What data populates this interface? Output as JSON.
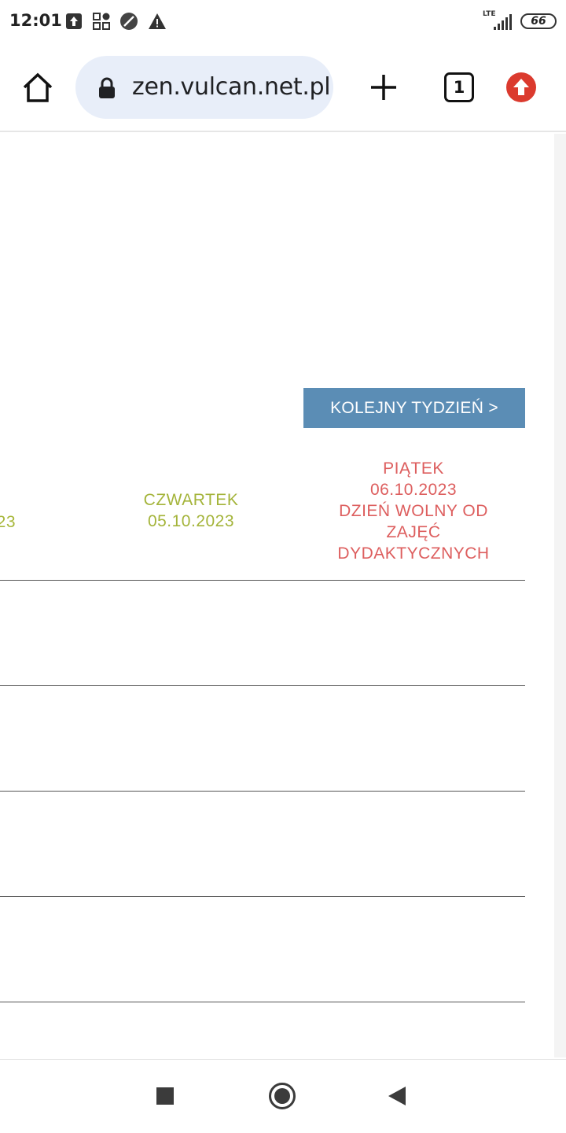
{
  "status_bar": {
    "time": "12:01",
    "icons": [
      "upload-icon",
      "apps-grid-icon",
      "data-saver-icon",
      "warning-icon"
    ],
    "network": "LTE",
    "battery": "66"
  },
  "browser": {
    "url": "zen.vulcan.net.pl",
    "tab_count": "1",
    "accent_color": "#db3a2e"
  },
  "page": {
    "next_week_button": "KOLEJNY TYDZIEŃ >",
    "prev_day_tail": "23",
    "thursday": {
      "name": "CZWARTEK",
      "date": "05.10.2023",
      "color": "#a4b43a"
    },
    "friday": {
      "name": "PIĄTEK",
      "date": "06.10.2023",
      "note_line1": "DZIEŃ WOLNY OD",
      "note_line2": "ZAJĘĆ",
      "note_line3": "DYDAKTYCZNYCH",
      "color": "#dd5e5e"
    },
    "button_color": "#5b8db5"
  }
}
